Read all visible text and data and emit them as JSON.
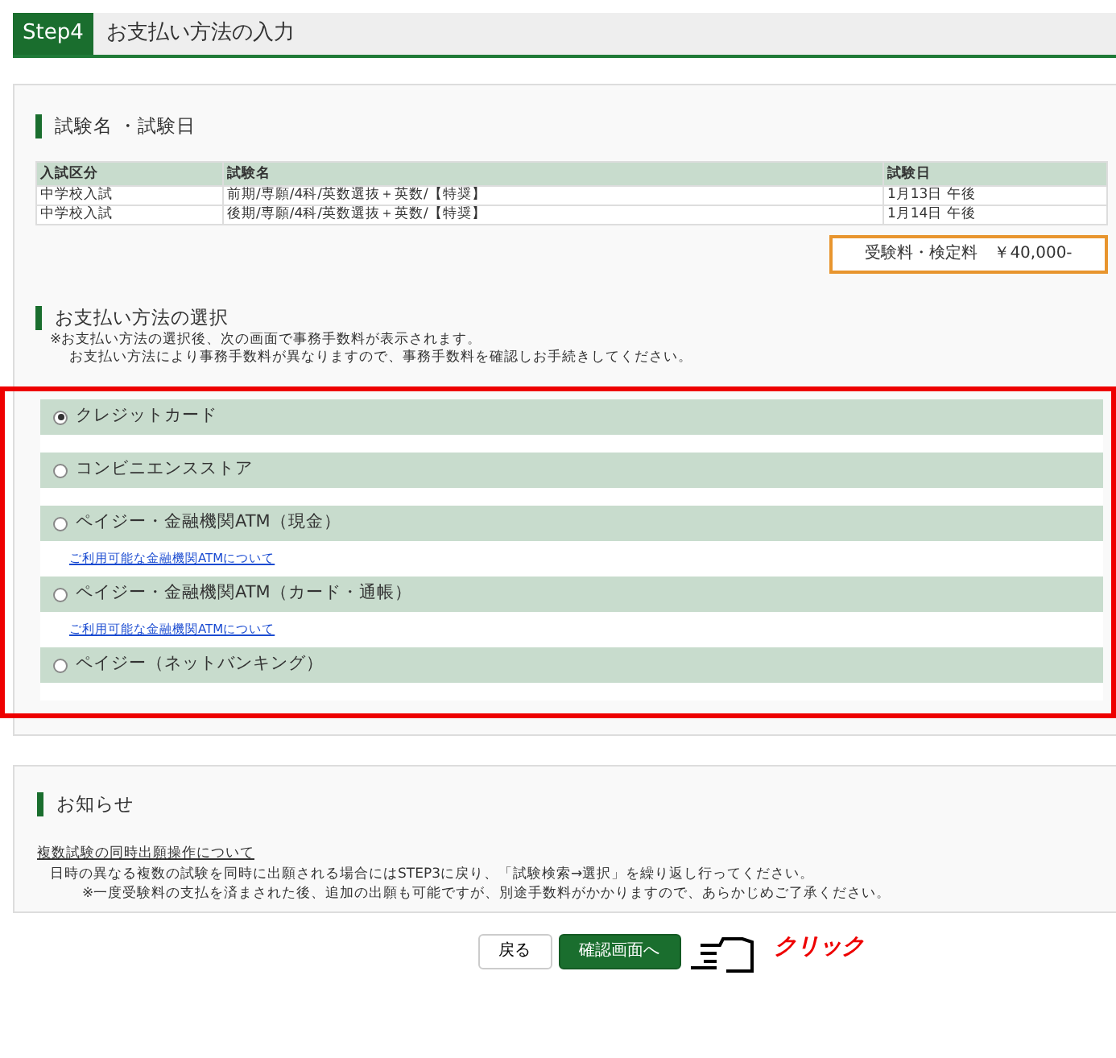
{
  "header": {
    "step": "Step4",
    "title": "お支払い方法の入力"
  },
  "exam_section": {
    "title": "試験名 ・試験日",
    "table": {
      "columns": [
        "入試区分",
        "試験名",
        "試験日"
      ],
      "rows": [
        [
          "中学校入試",
          "前期/専願/4科/英数選抜＋英数/【特奨】",
          "1月13日 午後"
        ],
        [
          "中学校入試",
          "後期/専願/4科/英数選抜＋英数/【特奨】",
          "1月14日 午後"
        ]
      ]
    },
    "fee": "受験料・検定料　￥40,000-"
  },
  "payment_section": {
    "title": "お支払い方法の選択",
    "notes": [
      "※お支払い方法の選択後、次の画面で事務手数料が表示されます。",
      "お支払い方法により事務手数料が異なりますので、事務手数料を確認しお手続きしてください。"
    ],
    "options": [
      {
        "label": "クレジットカード",
        "selected": true
      },
      {
        "label": "コンビニエンスストア",
        "selected": false
      },
      {
        "label": "ペイジー・金融機関ATM（現金）",
        "selected": false,
        "link": "ご利用可能な金融機関ATMについて"
      },
      {
        "label": "ペイジー・金融機関ATM（カード・通帳）",
        "selected": false,
        "link": "ご利用可能な金融機関ATMについて"
      },
      {
        "label": "ペイジー（ネットバンキング）",
        "selected": false
      }
    ]
  },
  "notice_section": {
    "title": "お知らせ",
    "link": "複数試験の同時出願操作について",
    "lines": [
      "日時の異なる複数の試験を同時に出願される場合にはSTEP3に戻り、「試験検索→選択」を繰り返し行ってください。",
      "※一度受験料の支払を済まされた後、追加の出願も可能ですが、別途手数料がかかりますので、あらかじめご了承ください。"
    ]
  },
  "buttons": {
    "back": "戻る",
    "next": "確認画面へ"
  },
  "annotation": "クリック"
}
